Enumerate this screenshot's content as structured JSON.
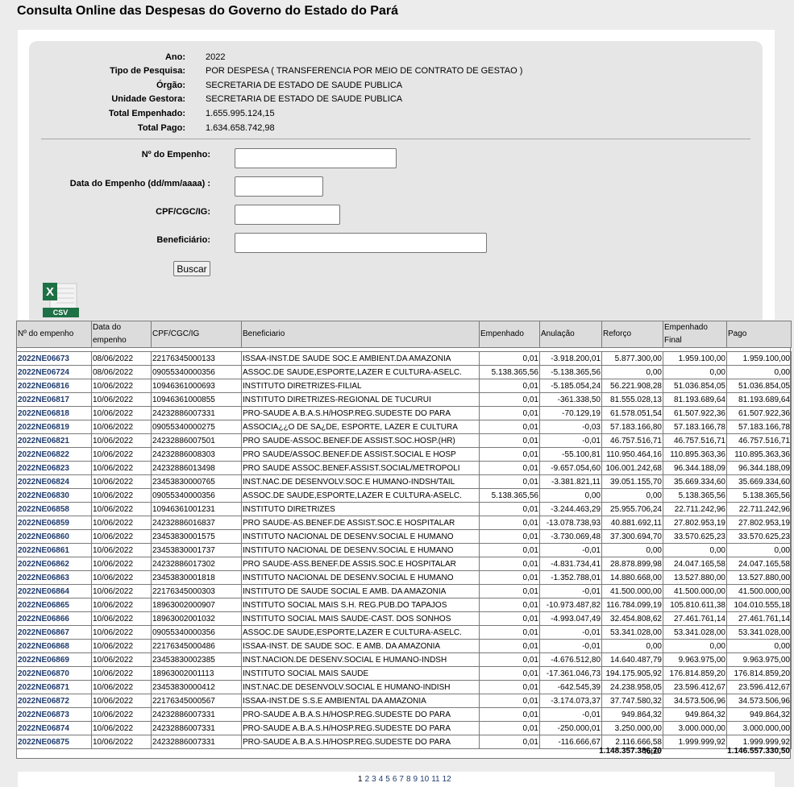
{
  "page": {
    "title": "Consulta Online das Despesas do Governo do Estado do Pará"
  },
  "info": [
    {
      "label": "Ano:",
      "value": "2022"
    },
    {
      "label": "Tipo de Pesquisa:",
      "value": "POR DESPESA ( TRANSFERENCIA POR MEIO DE CONTRATO DE GESTAO )"
    },
    {
      "label": "Órgão:",
      "value": "SECRETARIA DE ESTADO DE SAUDE PUBLICA"
    },
    {
      "label": "Unidade Gestora:",
      "value": "SECRETARIA DE ESTADO DE SAUDE PUBLICA"
    },
    {
      "label": "Total Empenhado:",
      "value": "1.655.995.124,15"
    },
    {
      "label": "Total Pago:",
      "value": "1.634.658.742,98"
    }
  ],
  "form": {
    "empenho_label": "Nº do Empenho:",
    "data_label": "Data do Empenho (dd/mm/aaaa) :",
    "cpf_label": "CPF/CGC/IG:",
    "beneficiario_label": "Beneficiário:",
    "search_button": "Buscar"
  },
  "csv": {
    "icon": "excel-csv-icon",
    "label": "CSV",
    "letter": "X",
    "color": "#1e7145"
  },
  "table": {
    "headers": [
      "Nº do empenho",
      "Data do empenho",
      "CPF/CGC/IG",
      "Beneficiario",
      "Empenhado",
      "Anulação",
      "Reforço",
      "Empenhado Final",
      "Pago"
    ],
    "rows": [
      [
        "2022NE06673",
        "08/06/2022",
        "22176345000133",
        "ISSAA-INST.DE SAUDE SOC.E AMBIENT.DA AMAZONIA",
        "0,01",
        "-3.918.200,01",
        "5.877.300,00",
        "1.959.100,00",
        "1.959.100,00"
      ],
      [
        "2022NE06724",
        "08/06/2022",
        "09055340000356",
        "ASSOC.DE SAUDE,ESPORTE,LAZER E CULTURA-ASELC.",
        "5.138.365,56",
        "-5.138.365,56",
        "0,00",
        "0,00",
        "0,00"
      ],
      [
        "2022NE06816",
        "10/06/2022",
        "10946361000693",
        "INSTITUTO DIRETRIZES-FILIAL",
        "0,01",
        "-5.185.054,24",
        "56.221.908,28",
        "51.036.854,05",
        "51.036.854,05"
      ],
      [
        "2022NE06817",
        "10/06/2022",
        "10946361000855",
        "INSTITUTO DIRETRIZES-REGIONAL DE TUCURUI",
        "0,01",
        "-361.338,50",
        "81.555.028,13",
        "81.193.689,64",
        "81.193.689,64"
      ],
      [
        "2022NE06818",
        "10/06/2022",
        "24232886007331",
        "PRO-SAUDE A.B.A.S.H/HOSP.REG.SUDESTE DO PARA",
        "0,01",
        "-70.129,19",
        "61.578.051,54",
        "61.507.922,36",
        "61.507.922,36"
      ],
      [
        "2022NE06819",
        "10/06/2022",
        "09055340000275",
        "ASSOCIA¿¿O DE SA¿DE, ESPORTE, LAZER E CULTURA",
        "0,01",
        "-0,03",
        "57.183.166,80",
        "57.183.166,78",
        "57.183.166,78"
      ],
      [
        "2022NE06821",
        "10/06/2022",
        "24232886007501",
        "PRO SAUDE-ASSOC.BENEF.DE ASSIST.SOC.HOSP.(HR)",
        "0,01",
        "-0,01",
        "46.757.516,71",
        "46.757.516,71",
        "46.757.516,71"
      ],
      [
        "2022NE06822",
        "10/06/2022",
        "24232886008303",
        "PRO SAUDE/ASSOC.BENEF.DE ASSIST.SOCIAL E HOSP",
        "0,01",
        "-55.100,81",
        "110.950.464,16",
        "110.895.363,36",
        "110.895.363,36"
      ],
      [
        "2022NE06823",
        "10/06/2022",
        "24232886013498",
        "PRO SAUDE ASSOC.BENEF.ASSIST.SOCIAL/METROPOLI",
        "0,01",
        "-9.657.054,60",
        "106.001.242,68",
        "96.344.188,09",
        "96.344.188,09"
      ],
      [
        "2022NE06824",
        "10/06/2022",
        "23453830000765",
        "INST.NAC.DE DESENVOLV.SOC.E HUMANO-INDSH/TAIL",
        "0,01",
        "-3.381.821,11",
        "39.051.155,70",
        "35.669.334,60",
        "35.669.334,60"
      ],
      [
        "2022NE06830",
        "10/06/2022",
        "09055340000356",
        "ASSOC.DE SAUDE,ESPORTE,LAZER E CULTURA-ASELC.",
        "5.138.365,56",
        "0,00",
        "0,00",
        "5.138.365,56",
        "5.138.365,56"
      ],
      [
        "2022NE06858",
        "10/06/2022",
        "10946361001231",
        "INSTITUTO DIRETRIZES",
        "0,01",
        "-3.244.463,29",
        "25.955.706,24",
        "22.711.242,96",
        "22.711.242,96"
      ],
      [
        "2022NE06859",
        "10/06/2022",
        "24232886016837",
        "PRO SAUDE-AS.BENEF.DE ASSIST.SOC.E HOSPITALAR",
        "0,01",
        "-13.078.738,93",
        "40.881.692,11",
        "27.802.953,19",
        "27.802.953,19"
      ],
      [
        "2022NE06860",
        "10/06/2022",
        "23453830001575",
        "INSTITUTO NACIONAL DE DESENV.SOCIAL E HUMANO",
        "0,01",
        "-3.730.069,48",
        "37.300.694,70",
        "33.570.625,23",
        "33.570.625,23"
      ],
      [
        "2022NE06861",
        "10/06/2022",
        "23453830001737",
        "INSTITUTO NACIONAL DE DESENV.SOCIAL E HUMANO",
        "0,01",
        "-0,01",
        "0,00",
        "0,00",
        "0,00"
      ],
      [
        "2022NE06862",
        "10/06/2022",
        "24232886017302",
        "PRO SAUDE-ASS.BENEF.DE ASSIS.SOC.E HOSPITALAR",
        "0,01",
        "-4.831.734,41",
        "28.878.899,98",
        "24.047.165,58",
        "24.047.165,58"
      ],
      [
        "2022NE06863",
        "10/06/2022",
        "23453830001818",
        "INSTITUTO NACIONAL DE DESENV.SOCIAL E HUMANO",
        "0,01",
        "-1.352.788,01",
        "14.880.668,00",
        "13.527.880,00",
        "13.527.880,00"
      ],
      [
        "2022NE06864",
        "10/06/2022",
        "22176345000303",
        "INSTITUTO DE SAUDE SOCIAL E AMB. DA AMAZONIA",
        "0,01",
        "-0,01",
        "41.500.000,00",
        "41.500.000,00",
        "41.500.000,00"
      ],
      [
        "2022NE06865",
        "10/06/2022",
        "18963002000907",
        "INSTITUTO SOCIAL MAIS S.H. REG.PUB.DO TAPAJOS",
        "0,01",
        "-10.973.487,82",
        "116.784.099,19",
        "105.810.611,38",
        "104.010.555,18"
      ],
      [
        "2022NE06866",
        "10/06/2022",
        "18963002001032",
        "INSTITUTO SOCIAL MAIS SAUDE-CAST. DOS SONHOS",
        "0,01",
        "-4.993.047,49",
        "32.454.808,62",
        "27.461.761,14",
        "27.461.761,14"
      ],
      [
        "2022NE06867",
        "10/06/2022",
        "09055340000356",
        "ASSOC.DE SAUDE,ESPORTE,LAZER E CULTURA-ASELC.",
        "0,01",
        "-0,01",
        "53.341.028,00",
        "53.341.028,00",
        "53.341.028,00"
      ],
      [
        "2022NE06868",
        "10/06/2022",
        "22176345000486",
        "ISSAA-INST. DE SAUDE SOC. E AMB. DA AMAZONIA",
        "0,01",
        "-0,01",
        "0,00",
        "0,00",
        "0,00"
      ],
      [
        "2022NE06869",
        "10/06/2022",
        "23453830002385",
        "INST.NACION.DE DESENV.SOCIAL E HUMANO-INDSH",
        "0,01",
        "-4.676.512,80",
        "14.640.487,79",
        "9.963.975,00",
        "9.963.975,00"
      ],
      [
        "2022NE06870",
        "10/06/2022",
        "18963002001113",
        "INSTITUTO SOCIAL MAIS SAUDE",
        "0,01",
        "-17.361.046,73",
        "194.175.905,92",
        "176.814.859,20",
        "176.814.859,20"
      ],
      [
        "2022NE06871",
        "10/06/2022",
        "23453830000412",
        "INST.NAC.DE DESENVOLV.SOCIAL E HUMANO-INDISH",
        "0,01",
        "-642.545,39",
        "24.238.958,05",
        "23.596.412,67",
        "23.596.412,67"
      ],
      [
        "2022NE06872",
        "10/06/2022",
        "22176345000567",
        "ISSAA-INST.DE S.S.E AMBIENTAL DA AMAZONIA",
        "0,01",
        "-3.174.073,37",
        "37.747.580,32",
        "34.573.506,96",
        "34.573.506,96"
      ],
      [
        "2022NE06873",
        "10/06/2022",
        "24232886007331",
        "PRO-SAUDE A.B.A.S.H/HOSP.REG.SUDESTE DO PARA",
        "0,01",
        "-0,01",
        "949.864,32",
        "949.864,32",
        "949.864,32"
      ],
      [
        "2022NE06874",
        "10/06/2022",
        "24232886007331",
        "PRO-SAUDE A.B.A.S.H/HOSP.REG.SUDESTE DO PARA",
        "0,01",
        "-250.000,01",
        "3.250.000,00",
        "3.000.000,00",
        "3.000.000,00"
      ],
      [
        "2022NE06875",
        "10/06/2022",
        "24232886007331",
        "PRO-SAUDE A.B.A.S.H/HOSP.REG.SUDESTE DO PARA",
        "0,01",
        "-116.666,67",
        "2.116.666,58",
        "1.999.999,92",
        "1.999.999,92"
      ]
    ],
    "total_label": "Total:",
    "total_empenhado_final": "1.148.357.386,70",
    "total_pago": "1.146.557.330,50"
  },
  "pagination": {
    "current": "1",
    "pages": [
      "2",
      "3",
      "4",
      "5",
      "6",
      "7",
      "8",
      "9",
      "10",
      "11",
      "12"
    ]
  }
}
